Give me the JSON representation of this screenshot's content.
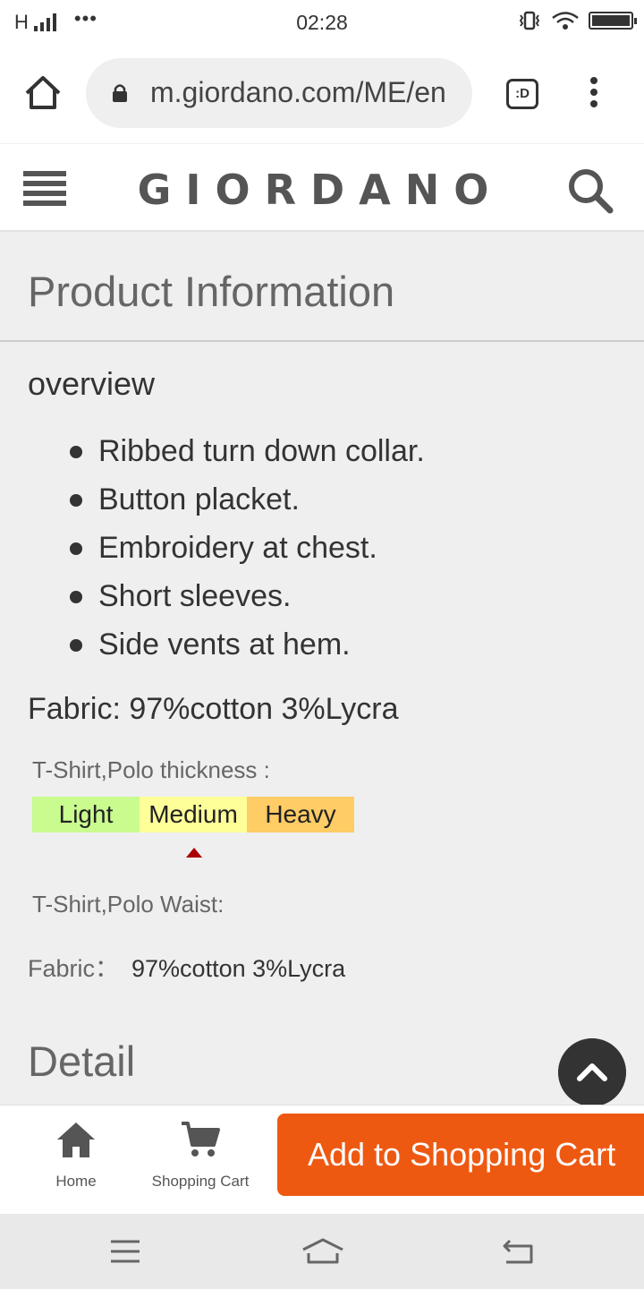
{
  "status_bar": {
    "network": "H",
    "more": "•••",
    "time": "02:28"
  },
  "browser": {
    "url": "m.giordano.com/ME/en",
    "tab_label": ":D"
  },
  "site": {
    "logo": "GIORDANO"
  },
  "product_info": {
    "title": "Product Information",
    "overview_heading": "overview",
    "features": [
      "Ribbed turn down collar.",
      "Button placket.",
      "Embroidery at chest.",
      "Short sleeves.",
      "Side vents at hem."
    ],
    "fabric_line": "Fabric: 97%cotton 3%Lycra",
    "thickness_label": "T-Shirt,Polo thickness :",
    "thickness_levels": [
      {
        "label": "Light",
        "color": "#c9fb8e"
      },
      {
        "label": "Medium",
        "color": "#ffff99"
      },
      {
        "label": "Heavy",
        "color": "#ffcc66"
      }
    ],
    "thickness_selected": "Medium",
    "waist_label": "T-Shirt,Polo Waist:",
    "fabric_key": "Fabric：",
    "fabric_value": "97%cotton 3%Lycra"
  },
  "detail": {
    "title": "Detail"
  },
  "bottom_bar": {
    "home_label": "Home",
    "cart_label": "Shopping Cart",
    "add_to_cart": "Add to Shopping Cart",
    "accent": "#ee5912"
  }
}
